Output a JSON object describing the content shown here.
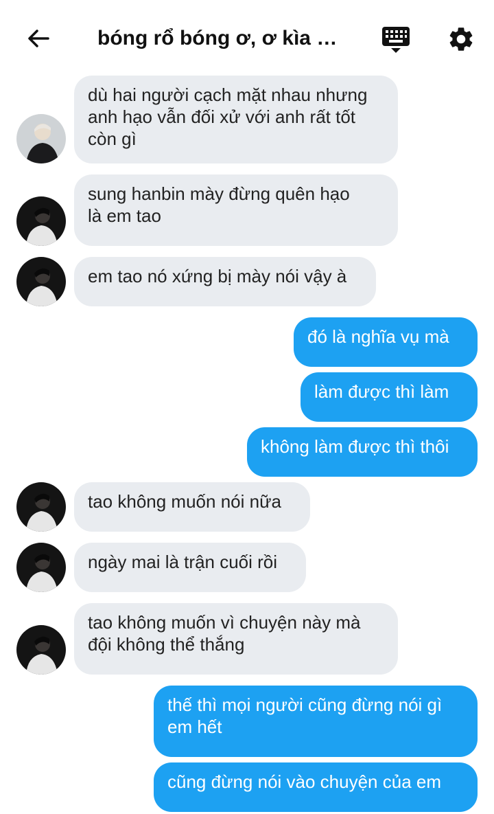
{
  "header": {
    "title": "bóng rổ bóng ơ, ơ kìa b...",
    "back_icon": "arrow-left-icon",
    "keyboard_icon": "keyboard-icon",
    "settings_icon": "gear-icon"
  },
  "colors": {
    "incoming_bubble": "#e9ecf0",
    "outgoing_bubble": "#1da1f2",
    "background": "#ffffff"
  },
  "messages": [
    {
      "direction": "in",
      "avatar": "avatar-blond",
      "text": "dù hai người cạch mặt nhau nhưng\nanh hạo vẫn đối xử với anh rất tốt\ncòn gì"
    },
    {
      "direction": "in",
      "avatar": "avatar-dark",
      "text": "sung hanbin mày đừng quên hạo\nlà em tao"
    },
    {
      "direction": "in",
      "avatar": "avatar-dark",
      "text": "em tao nó xứng bị mày nói vậy à"
    },
    {
      "direction": "out",
      "text": "đó là nghĩa vụ mà"
    },
    {
      "direction": "out",
      "text": "làm được thì làm"
    },
    {
      "direction": "out",
      "text": "không làm được thì thôi"
    },
    {
      "direction": "in",
      "avatar": "avatar-dark",
      "text": "tao không muốn nói nữa"
    },
    {
      "direction": "in",
      "avatar": "avatar-dark",
      "text": "ngày mai là trận cuối rồi"
    },
    {
      "direction": "in",
      "avatar": "avatar-dark",
      "text": "tao không muốn vì chuyện này mà\nđội không thể thắng"
    },
    {
      "direction": "out",
      "text": "thế thì mọi người cũng đừng nói gì\nem hết"
    },
    {
      "direction": "out",
      "text": "cũng đừng nói vào chuyện của em"
    }
  ]
}
